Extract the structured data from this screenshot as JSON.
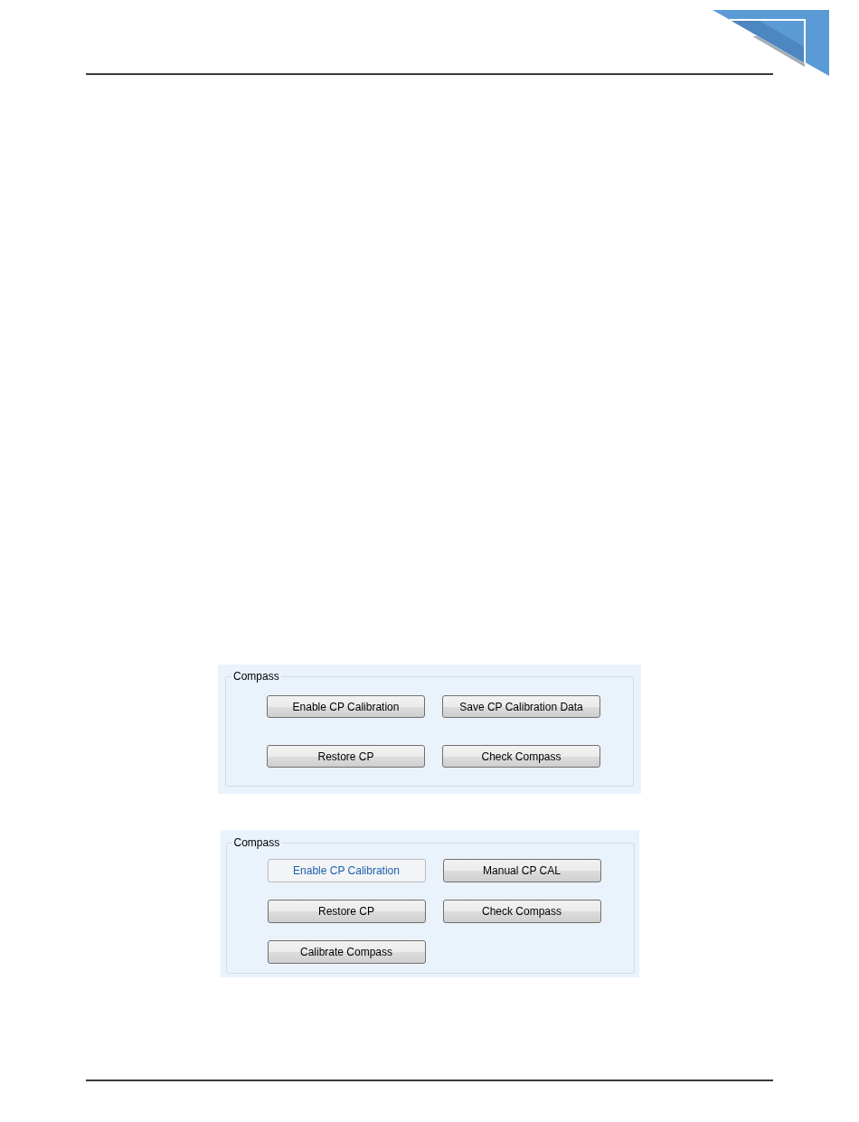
{
  "panels": [
    {
      "title": "Compass",
      "buttons": [
        {
          "label": "Enable CP Calibration",
          "disabled": false
        },
        {
          "label": "Save CP Calibration Data",
          "disabled": false
        },
        {
          "label": "Restore CP",
          "disabled": false
        },
        {
          "label": "Check Compass",
          "disabled": false
        }
      ]
    },
    {
      "title": "Compass",
      "buttons": [
        {
          "label": "Enable CP Calibration",
          "disabled": true
        },
        {
          "label": "Manual CP CAL",
          "disabled": false
        },
        {
          "label": "Restore CP",
          "disabled": false
        },
        {
          "label": "Check Compass",
          "disabled": false
        },
        {
          "label": "Calibrate Compass",
          "disabled": false
        }
      ]
    }
  ]
}
